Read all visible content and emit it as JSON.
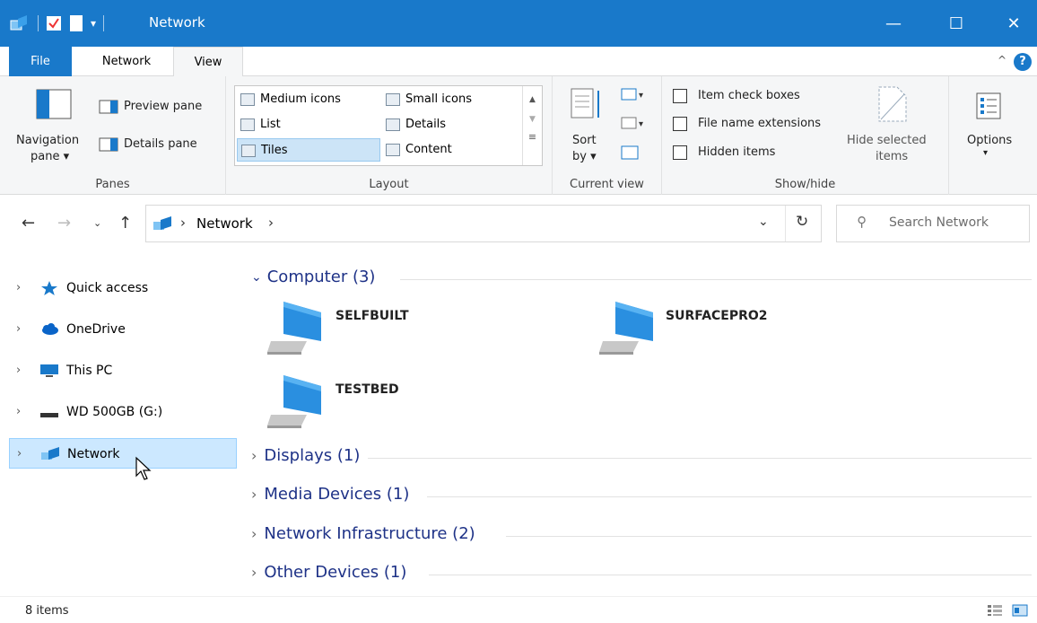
{
  "window": {
    "title": "Network",
    "minimize": "—",
    "maximize": "☐",
    "close": "✕"
  },
  "ribbon_tabs": {
    "file": "File",
    "network": "Network",
    "view": "View",
    "help": "?"
  },
  "panes": {
    "navigation_pane": "Navigation",
    "navigation_pane_line2": "pane ▾",
    "preview_pane": "Preview pane",
    "details_pane": "Details pane",
    "group_label": "Panes"
  },
  "layout": {
    "medium_icons": "Medium icons",
    "small_icons": "Small icons",
    "list": "List",
    "details": "Details",
    "tiles": "Tiles",
    "content": "Content",
    "group_label": "Layout"
  },
  "current_view": {
    "sort_by": "Sort",
    "sort_by_line2": "by ▾",
    "group_label": "Current view"
  },
  "show_hide": {
    "item_check_boxes": "Item check boxes",
    "file_name_extensions": "File name extensions",
    "hidden_items": "Hidden items",
    "hide_selected": "Hide selected",
    "hide_selected_line2": "items",
    "group_label": "Show/hide"
  },
  "options": {
    "label": "Options",
    "arrow": "▾"
  },
  "address": {
    "sep1": "›",
    "location": "Network",
    "sep2": "›",
    "search_placeholder": "Search Network"
  },
  "nav_pane": {
    "items": [
      {
        "label": "Quick access"
      },
      {
        "label": "OneDrive"
      },
      {
        "label": "This PC"
      },
      {
        "label": "WD 500GB (G:)"
      },
      {
        "label": "Network"
      }
    ]
  },
  "content": {
    "groups": [
      {
        "label": "Computer (3)",
        "expanded": true
      },
      {
        "label": "Displays (1)",
        "expanded": false
      },
      {
        "label": "Media Devices (1)",
        "expanded": false
      },
      {
        "label": "Network Infrastructure (2)",
        "expanded": false
      },
      {
        "label": "Other Devices (1)",
        "expanded": false
      }
    ],
    "computers": [
      {
        "name": "SELFBUILT"
      },
      {
        "name": "SURFACEPRO2"
      },
      {
        "name": "TESTBED"
      }
    ]
  },
  "status": {
    "item_count": "8 items"
  },
  "colors": {
    "titlebar": "#1979ca",
    "accent": "#1979ca",
    "group_header": "#1e3287",
    "selection": "#cce8ff"
  }
}
